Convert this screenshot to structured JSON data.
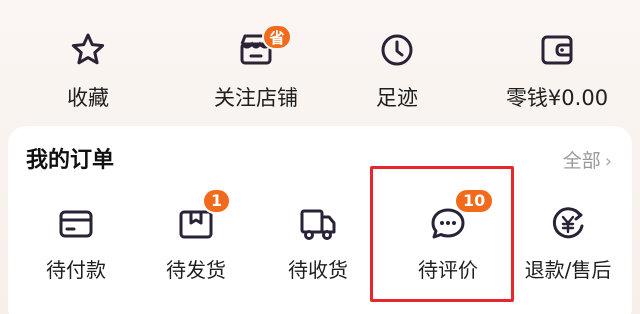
{
  "quick_actions": [
    {
      "label": "收藏",
      "icon": "star-icon"
    },
    {
      "label": "关注店铺",
      "icon": "shop-icon",
      "badge": "省"
    },
    {
      "label": "足迹",
      "icon": "clock-icon"
    },
    {
      "label": "零钱¥0.00",
      "icon": "wallet-icon"
    }
  ],
  "orders": {
    "title": "我的订单",
    "all_label": "全部",
    "chevron": "›",
    "items": [
      {
        "label": "待付款",
        "icon": "card-icon"
      },
      {
        "label": "待发货",
        "icon": "package-icon",
        "badge": "1"
      },
      {
        "label": "待收货",
        "icon": "truck-icon"
      },
      {
        "label": "待评价",
        "icon": "chat-bubble-icon",
        "badge": "10"
      },
      {
        "label": "退款/售后",
        "icon": "refund-icon"
      }
    ]
  },
  "colors": {
    "accent": "#f26a1b",
    "icon_stroke": "#2a2236",
    "highlight": "#e8262d"
  }
}
